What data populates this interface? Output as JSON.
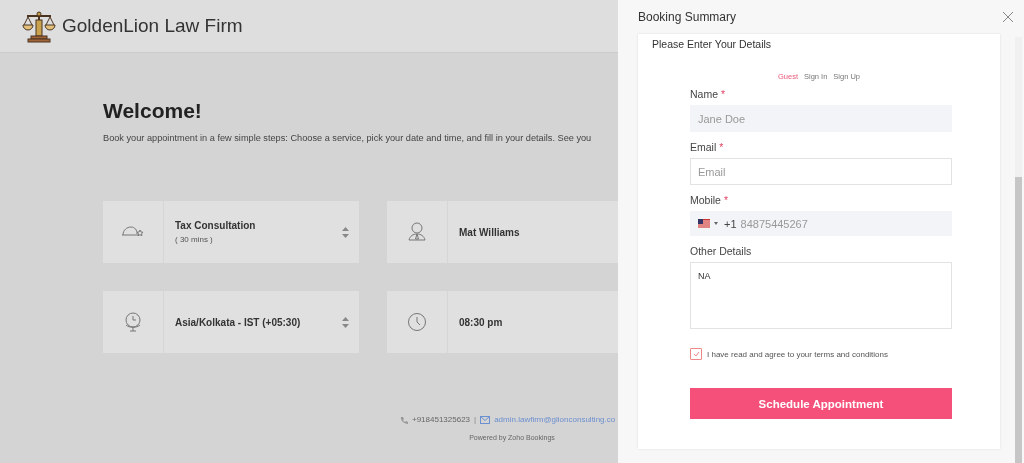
{
  "header": {
    "title": "GoldenLion Law Firm"
  },
  "welcome": {
    "heading": "Welcome!",
    "intro": "Book your appointment in a few simple steps: Choose a service, pick your date and time, and fill in your details. See you"
  },
  "cards": [
    {
      "kind": "select",
      "title": "Tax Consultation",
      "subtitle": "( 30 mins )"
    },
    {
      "kind": "plain",
      "title": "Mat Williams"
    },
    {
      "kind": "select",
      "title": "Asia/Kolkata - IST (+05:30)"
    },
    {
      "kind": "plain",
      "title": "08:30 pm"
    }
  ],
  "footer": {
    "phone": "+918451325623",
    "separator": "|",
    "email": "admin.lawfirm@glionconsulting.co",
    "powered_by": "Powered by Zoho Bookings"
  },
  "panel": {
    "title": "Booking Summary",
    "section_title": "Please Enter Your Details",
    "tabs": [
      {
        "label": "Guest",
        "selected": true
      },
      {
        "label": "Sign In",
        "selected": false
      },
      {
        "label": "Sign Up",
        "selected": false
      }
    ],
    "fields": [
      {
        "kind": "text",
        "label": "Name",
        "required_mark": "*",
        "placeholder": "Jane Doe"
      },
      {
        "kind": "text",
        "label": "Email",
        "required_mark": "*",
        "placeholder": "Email"
      },
      {
        "kind": "phone",
        "label": "Mobile",
        "required_mark": "*",
        "country_code": "+1",
        "placeholder": "84875445267"
      },
      {
        "kind": "textarea",
        "label": "Other Details",
        "value": "NA"
      }
    ],
    "terms": {
      "label": "I have read and agree to your terms and conditions",
      "checked": true
    },
    "submit": "Schedule Appointment"
  }
}
